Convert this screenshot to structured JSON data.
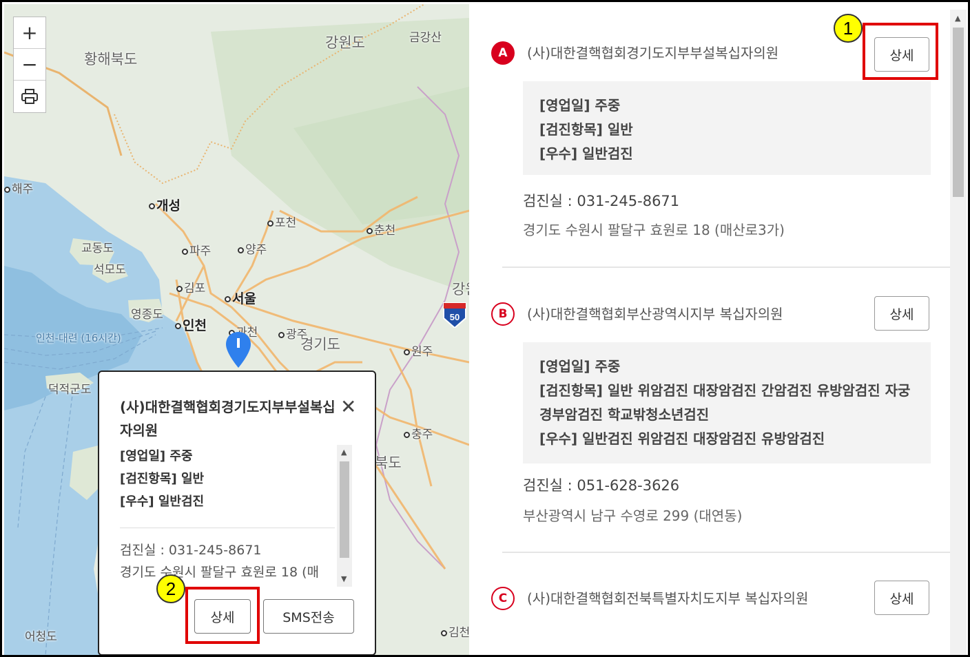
{
  "map": {
    "zoom_in": "+",
    "zoom_out": "−",
    "print_icon": "printer-icon",
    "highway_number": "50",
    "labels": {
      "hwanghae": "황해북도",
      "gangwon": "강원도",
      "geumgang": "금강산",
      "haeju": "해주",
      "kaesong": "개성",
      "pocheon": "포천",
      "chuncheon": "춘천",
      "gyodong": "교동도",
      "paju": "파주",
      "yangju": "양주",
      "seongmo": "석모도",
      "gimpo": "김포",
      "seoul": "서울",
      "gang2": "강원",
      "yeongjong": "영종도",
      "incheon": "인천",
      "gwacheon": "과천",
      "gwangju": "광주",
      "gyeonggi": "경기도",
      "wonju": "원주",
      "route": "인천-대련 (16시간)",
      "deokjeok": "덕적군도",
      "chungju": "충주",
      "bukdo": "북도",
      "eocheong": "어청도",
      "gimcheon": "김천"
    }
  },
  "popup": {
    "title": "(사)대한결핵협회경기도지부부설복십자의원",
    "close_icon": "close-icon",
    "info": [
      "[영업일] 주중",
      "[검진항목] 일반",
      "[우수] 일반검진"
    ],
    "phone": "검진실 : 031-245-8671",
    "address": "경기도 수원시 팔달구 효원로 18 (매",
    "detail_label": "상세",
    "sms_label": "SMS전송"
  },
  "list": {
    "items": [
      {
        "badge": "A",
        "name": "(사)대한결핵협회경기도지부부설복십자의원",
        "detail_label": "상세",
        "info": [
          "[영업일] 주중",
          "[검진항목] 일반",
          "[우수] 일반검진"
        ],
        "phone": "검진실 :  031-245-8671",
        "address": "경기도 수원시 팔달구 효원로 18 (매산로3가)"
      },
      {
        "badge": "B",
        "name": "(사)대한결핵협회부산광역시지부 복십자의원",
        "detail_label": "상세",
        "info": [
          "[영업일] 주중",
          "[검진항목] 일반 위암검진 대장암검진 간암검진 유방암검진 자궁경부암검진 학교밖청소년검진",
          "[우수] 일반검진 위암검진 대장암검진 유방암검진"
        ],
        "phone": "검진실 :  051-628-3626",
        "address": "부산광역시 남구 수영로 299 (대연동)"
      },
      {
        "badge": "C",
        "name": "(사)대한결핵협회전북특별자치도지부 복십자의원",
        "detail_label": "상세"
      }
    ]
  },
  "annotations": {
    "step1": "1",
    "step2": "2",
    "highlight_color": "#e00000",
    "badge_color": "#d8001e",
    "marker_color": "#2f80ed"
  }
}
